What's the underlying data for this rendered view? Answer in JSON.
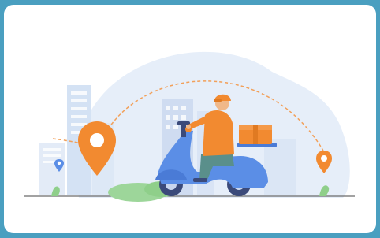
{
  "frame": {
    "background_color": "#4a9fc0",
    "card_color": "#ffffff"
  },
  "illustration": {
    "subject": "delivery-scooter-rider",
    "colors": {
      "accent_orange": "#f28a30",
      "scooter_blue": "#5b8ee6",
      "building_light": "#dbe6f5",
      "building_mid": "#c7d7ee",
      "ground_line": "#6b6b6b",
      "route_dashes": "#f2a05a",
      "plant_green": "#8fcf8a"
    },
    "icons": [
      "location-pin-icon",
      "location-pin-icon",
      "location-pin-icon",
      "delivery-box-icon"
    ]
  }
}
